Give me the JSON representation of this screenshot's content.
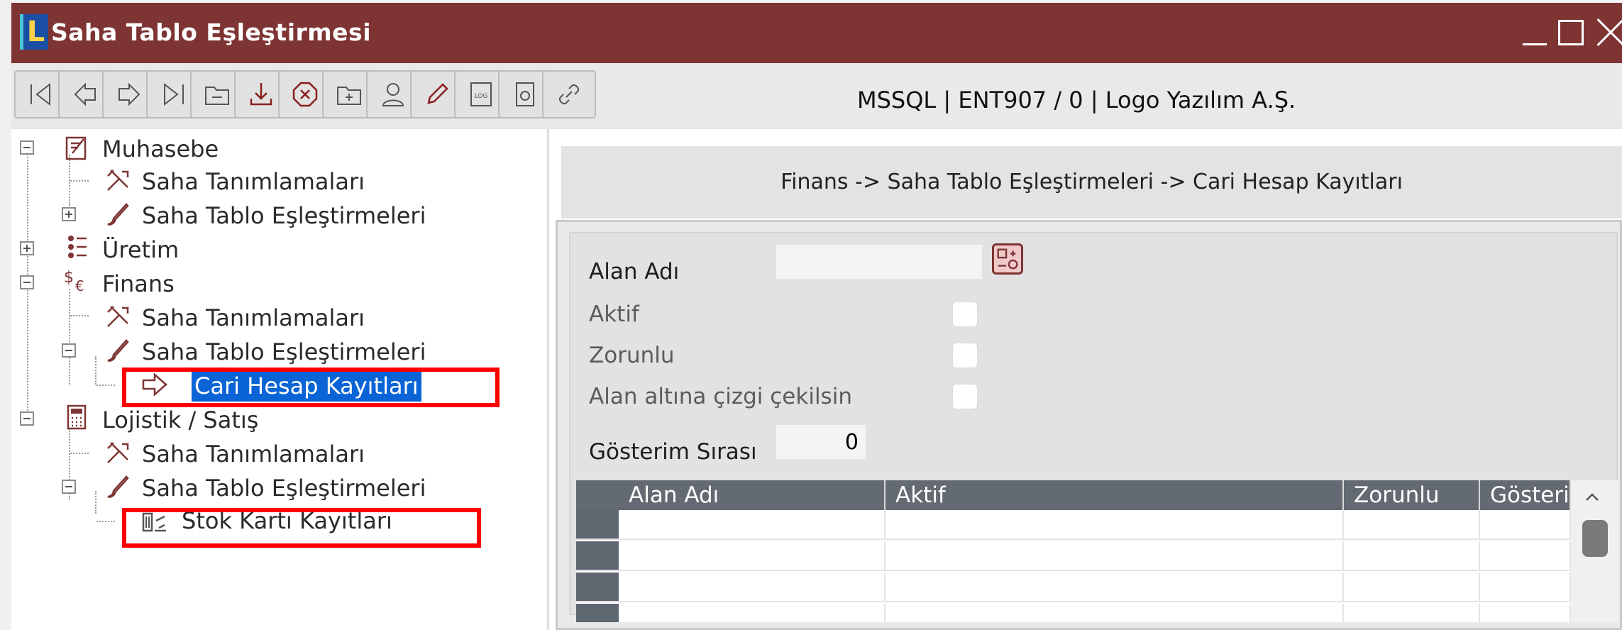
{
  "window": {
    "title": "Saha Tablo Eşleştirmesi",
    "icon_letter": "L",
    "title_color": "#7d3433"
  },
  "toolbar": {
    "buttons": [
      {
        "icon": "first-record-icon"
      },
      {
        "icon": "previous-record-icon"
      },
      {
        "icon": "next-record-icon"
      },
      {
        "icon": "last-record-icon"
      },
      {
        "icon": "folder-icon"
      },
      {
        "icon": "save-download-icon"
      },
      {
        "icon": "cancel-icon"
      },
      {
        "icon": "new-folder-icon"
      },
      {
        "icon": "user-icon"
      },
      {
        "icon": "edit-pencil-icon"
      },
      {
        "icon": "log-icon"
      },
      {
        "icon": "document-icon"
      },
      {
        "icon": "link-icon"
      }
    ],
    "connection_info": "MSSQL | ENT907 / 0 | Logo Yazılım A.Ş."
  },
  "tree": {
    "muhasebe": "Muhasebe",
    "muhasebe_saha_tanimlamalari": "Saha Tanımlamaları",
    "muhasebe_saha_tablo": "Saha Tablo Eşleştirmeleri",
    "uretim": "Üretim",
    "finans": "Finans",
    "finans_saha_tanimlamalari": "Saha Tanımlamaları",
    "finans_saha_tablo": "Saha Tablo Eşleştirmeleri",
    "cari_hesap": "Cari Hesap Kayıtları",
    "lojistik": "Lojistik / Satış",
    "lojistik_saha_tanimlamalari": "Saha Tanımlamaları",
    "lojistik_saha_tablo": "Saha Tablo Eşleştirmeleri",
    "stok_karti": "Stok Kartı Kayıtları"
  },
  "breadcrumb": "Finans -> Saha Tablo Eşleştirmeleri -> Cari Hesap Kayıtları",
  "form": {
    "alan_adi_label": "Alan Adı",
    "alan_adi_value": "",
    "aktif_label": "Aktif",
    "aktif_checked": false,
    "zorunlu_label": "Zorunlu",
    "zorunlu_checked": false,
    "cizgi_label": "Alan altına çizgi çekilsin",
    "cizgi_checked": false,
    "gosterim_label": "Gösterim Sırası",
    "gosterim_value": "0"
  },
  "grid": {
    "columns": [
      "Alan Adı",
      "Aktif",
      "Zorunlu",
      "Gösterim"
    ],
    "rows": [
      [
        "",
        "",
        "",
        ""
      ],
      [
        "",
        "",
        "",
        ""
      ],
      [
        "",
        "",
        "",
        ""
      ],
      [
        "",
        "",
        "",
        ""
      ]
    ]
  }
}
